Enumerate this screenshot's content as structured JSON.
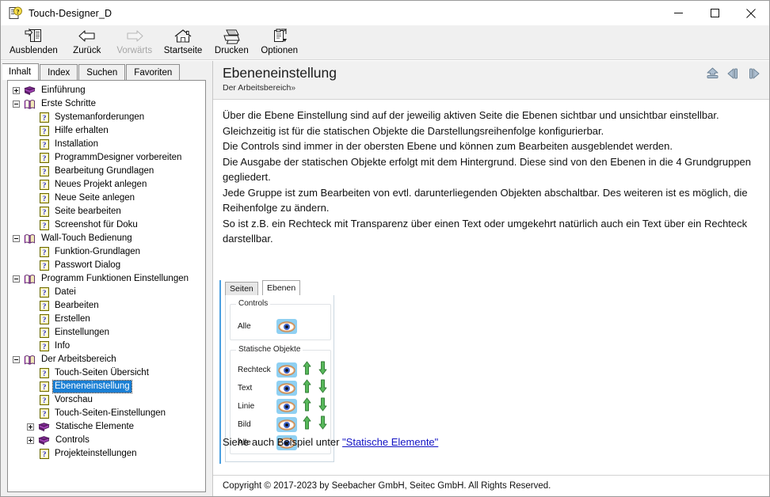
{
  "window": {
    "title": "Touch-Designer_D",
    "icon": "help-document-icon",
    "minimize_label": "–",
    "maximize_label": "□",
    "close_label": "✕"
  },
  "toolbar": {
    "items": [
      {
        "label": "Ausblenden",
        "icon": "hide-pane-icon",
        "disabled": false
      },
      {
        "label": "Zurück",
        "icon": "back-arrow-icon",
        "disabled": false
      },
      {
        "label": "Vorwärts",
        "icon": "forward-arrow-icon",
        "disabled": true
      },
      {
        "label": "Startseite",
        "icon": "home-icon",
        "disabled": false
      },
      {
        "label": "Drucken",
        "icon": "printer-icon",
        "disabled": false
      },
      {
        "label": "Optionen",
        "icon": "options-icon",
        "disabled": false
      }
    ]
  },
  "sidebar": {
    "tabs": [
      {
        "label": "Inhalt",
        "active": true
      },
      {
        "label": "Index",
        "active": false
      },
      {
        "label": "Suchen",
        "active": false
      },
      {
        "label": "Favoriten",
        "active": false
      }
    ],
    "tree": [
      {
        "label": "Einführung",
        "icon": "closed-book-icon",
        "expander": "plus",
        "indent": 0,
        "selected": false
      },
      {
        "label": "Erste Schritte",
        "icon": "open-book-icon",
        "expander": "minus",
        "indent": 0,
        "selected": false
      },
      {
        "label": "Systemanforderungen",
        "icon": "help-topic-icon",
        "expander": "none",
        "indent": 1,
        "selected": false
      },
      {
        "label": "Hilfe erhalten",
        "icon": "help-topic-icon",
        "expander": "none",
        "indent": 1,
        "selected": false
      },
      {
        "label": "Installation",
        "icon": "help-topic-icon",
        "expander": "none",
        "indent": 1,
        "selected": false
      },
      {
        "label": "ProgrammDesigner vorbereiten",
        "icon": "help-topic-icon",
        "expander": "none",
        "indent": 1,
        "selected": false
      },
      {
        "label": "Bearbeitung Grundlagen",
        "icon": "help-topic-icon",
        "expander": "none",
        "indent": 1,
        "selected": false
      },
      {
        "label": "Neues Projekt anlegen",
        "icon": "help-topic-icon",
        "expander": "none",
        "indent": 1,
        "selected": false
      },
      {
        "label": "Neue Seite anlegen",
        "icon": "help-topic-icon",
        "expander": "none",
        "indent": 1,
        "selected": false
      },
      {
        "label": "Seite bearbeiten",
        "icon": "help-topic-icon",
        "expander": "none",
        "indent": 1,
        "selected": false
      },
      {
        "label": "Screenshot für Doku",
        "icon": "help-topic-icon",
        "expander": "none",
        "indent": 1,
        "selected": false
      },
      {
        "label": "Wall-Touch Bedienung",
        "icon": "open-book-icon",
        "expander": "minus",
        "indent": 0,
        "selected": false
      },
      {
        "label": "Funktion-Grundlagen",
        "icon": "help-topic-icon",
        "expander": "none",
        "indent": 1,
        "selected": false
      },
      {
        "label": "Passwort Dialog",
        "icon": "help-topic-icon",
        "expander": "none",
        "indent": 1,
        "selected": false
      },
      {
        "label": "Programm Funktionen Einstellungen",
        "icon": "open-book-icon",
        "expander": "minus",
        "indent": 0,
        "selected": false
      },
      {
        "label": "Datei",
        "icon": "help-topic-icon",
        "expander": "none",
        "indent": 1,
        "selected": false
      },
      {
        "label": "Bearbeiten",
        "icon": "help-topic-icon",
        "expander": "none",
        "indent": 1,
        "selected": false
      },
      {
        "label": "Erstellen",
        "icon": "help-topic-icon",
        "expander": "none",
        "indent": 1,
        "selected": false
      },
      {
        "label": "Einstellungen",
        "icon": "help-topic-icon",
        "expander": "none",
        "indent": 1,
        "selected": false
      },
      {
        "label": "Info",
        "icon": "help-topic-icon",
        "expander": "none",
        "indent": 1,
        "selected": false
      },
      {
        "label": "Der Arbeitsbereich",
        "icon": "open-book-icon",
        "expander": "minus",
        "indent": 0,
        "selected": false
      },
      {
        "label": "Touch-Seiten Übersicht",
        "icon": "help-topic-icon",
        "expander": "none",
        "indent": 1,
        "selected": false
      },
      {
        "label": "Ebeneneinstellung",
        "icon": "help-topic-icon",
        "expander": "none",
        "indent": 1,
        "selected": true
      },
      {
        "label": "Vorschau",
        "icon": "help-topic-icon",
        "expander": "none",
        "indent": 1,
        "selected": false
      },
      {
        "label": "Touch-Seiten-Einstellungen",
        "icon": "help-topic-icon",
        "expander": "none",
        "indent": 1,
        "selected": false
      },
      {
        "label": "Statische Elemente",
        "icon": "closed-book-icon",
        "expander": "plus",
        "indent": 1,
        "selected": false
      },
      {
        "label": "Controls",
        "icon": "closed-book-icon",
        "expander": "plus",
        "indent": 1,
        "selected": false
      },
      {
        "label": "Projekteinstellungen",
        "icon": "help-topic-icon",
        "expander": "none",
        "indent": 1,
        "selected": false
      }
    ]
  },
  "document": {
    "title": "Ebeneneinstellung",
    "breadcrumb": "Der Arbeitsbereich",
    "breadcrumb_chevron": "››",
    "nav": [
      {
        "name": "up",
        "label": "Nach oben"
      },
      {
        "name": "previous",
        "label": "Zurück"
      },
      {
        "name": "next",
        "label": "Weiter"
      }
    ],
    "paragraphs": [
      "Über die Ebene Einstellung sind auf der jeweilig aktiven Seite die Ebenen sichtbar und unsichtbar einstellbar.",
      "Gleichzeitig ist für die statischen Objekte die Darstellungsreihenfolge konfigurierbar.",
      "Die Controls sind immer in der obersten Ebene und können zum Bearbeiten ausgeblendet werden.",
      "Die Ausgabe der statischen Objekte erfolgt mit dem Hintergrund. Diese sind von den Ebenen in die 4 Grundgruppen gegliedert.",
      "Jede Gruppe ist zum Bearbeiten von evtl. darunterliegenden Objekten abschaltbar. Des weiteren ist es möglich, die Reihenfolge zu ändern.",
      "So ist z.B. ein Rechteck mit Transparenz über einen Text oder umgekehrt natürlich auch ein Text über ein Rechteck darstellbar."
    ],
    "see_also_prefix": "Siehe auch Beispiel unter ",
    "see_also_link": "\"Statische Elemente\"",
    "copyright": "Copyright © 2017-2023 by Seebacher GmbH, Seitec GmbH. All Rights Reserved."
  },
  "widget": {
    "tabs": [
      {
        "label": "Seiten",
        "active": false
      },
      {
        "label": "Ebenen",
        "active": true
      }
    ],
    "groups": [
      {
        "title": "Controls",
        "rows": [
          {
            "label": "Alle",
            "eye": "eye-visible-icon",
            "up": false,
            "down": false
          }
        ]
      },
      {
        "title": "Statische Objekte",
        "rows": [
          {
            "label": "Rechteck",
            "eye": "eye-visible-icon",
            "up": true,
            "down": true
          },
          {
            "label": "Text",
            "eye": "eye-visible-icon",
            "up": true,
            "down": true
          },
          {
            "label": "Linie",
            "eye": "eye-visible-icon",
            "up": true,
            "down": true
          },
          {
            "label": "Bild",
            "eye": "eye-visible-icon",
            "up": true,
            "down": true
          },
          {
            "label": "Alle",
            "eye": "eye-visible-icon",
            "up": false,
            "down": false
          }
        ]
      }
    ]
  },
  "colors": {
    "selection": "#1a7fd4",
    "link": "#1212c4",
    "toolbar_bg": "#f0f0f0",
    "header_bg": "#f1f1f1",
    "eye_button_bg": "#8fd0f2",
    "arrow_green": "#4caf50",
    "widget_accent": "#4a9fe0"
  }
}
